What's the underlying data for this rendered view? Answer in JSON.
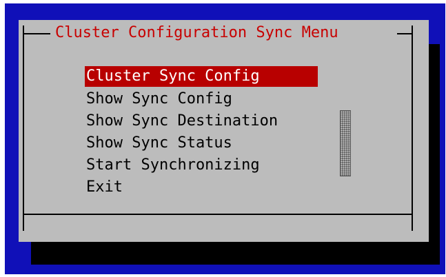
{
  "dialog": {
    "title": "Cluster Configuration Sync Menu"
  },
  "menu": {
    "selected_index": 0,
    "items": [
      {
        "label": "Cluster Sync Config"
      },
      {
        "label": "Show Sync Config"
      },
      {
        "label": "Show Sync Destination"
      },
      {
        "label": "Show Sync Status"
      },
      {
        "label": "Start Synchronizing"
      },
      {
        "label": "Exit"
      }
    ]
  },
  "colors": {
    "screen_background": "#1010b8",
    "dialog_background": "#bcbcbc",
    "title_text": "#c80000",
    "selection_highlight": "#b80000",
    "shadow": "#000000"
  },
  "scrollbar": {
    "icon": "scrollbar-thumb-icon"
  }
}
